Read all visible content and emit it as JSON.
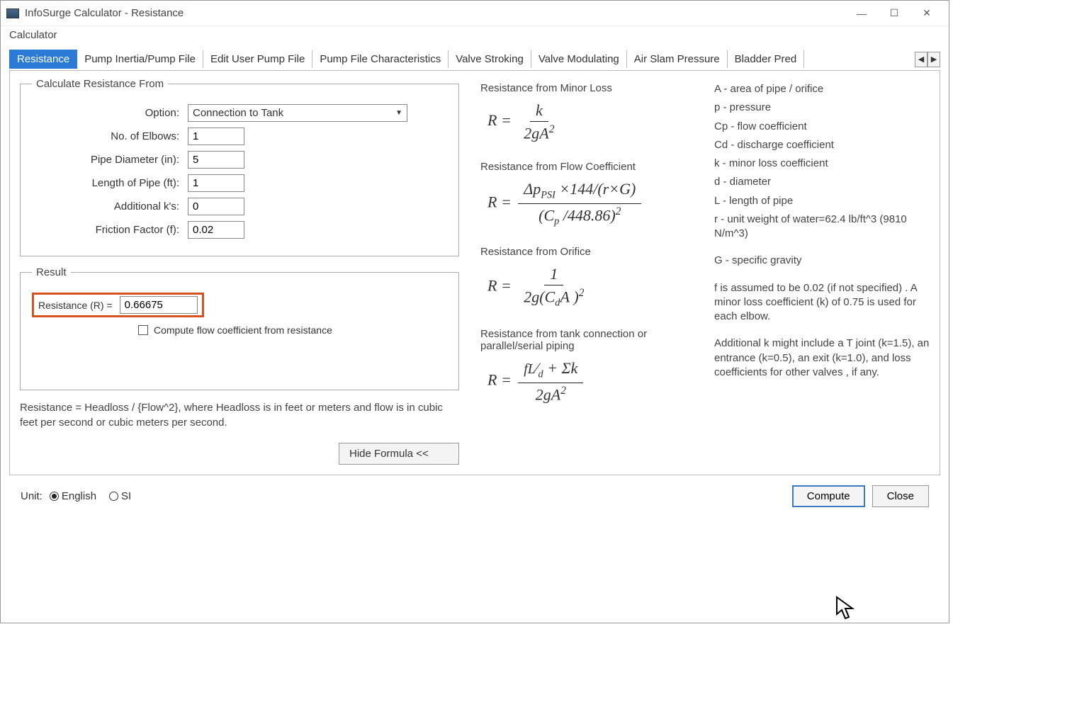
{
  "window": {
    "title": "InfoSurge Calculator - Resistance",
    "menubar_item": "Calculator"
  },
  "tabs": [
    "Resistance",
    "Pump Inertia/Pump File",
    "Edit User Pump File",
    "Pump File Characteristics",
    "Valve Stroking",
    "Valve Modulating",
    "Air Slam Pressure",
    "Bladder Pred"
  ],
  "active_tab_index": 0,
  "calc_from": {
    "legend": "Calculate Resistance From",
    "option_label": "Option:",
    "option_value": "Connection to Tank",
    "fields": [
      {
        "label": "No. of Elbows:",
        "value": "1"
      },
      {
        "label": "Pipe Diameter (in):",
        "value": "5"
      },
      {
        "label": "Length of Pipe (ft):",
        "value": "1"
      },
      {
        "label": "Additional k's:",
        "value": "0"
      },
      {
        "label": "Friction Factor (f):",
        "value": "0.02"
      }
    ]
  },
  "result": {
    "legend": "Result",
    "label": "Resistance (R)  =",
    "value": "0.66675",
    "checkbox_label": "Compute flow coefficient from resistance"
  },
  "note": "Resistance = Headloss / {Flow^2}, where Headloss is in feet or meters and flow is in cubic feet per second or cubic meters per second.",
  "hide_formula_btn": "Hide Formula <<",
  "formulas": {
    "minor_loss_label": "Resistance from Minor Loss",
    "flow_coeff_label": "Resistance from Flow Coefficient",
    "orifice_label": "Resistance from Orifice",
    "tank_label": "Resistance from tank connection or parallel/serial piping"
  },
  "glossary": [
    "A - area of pipe / orifice",
    "p - pressure",
    "Cp - flow coefficient",
    "Cd - discharge coefficient",
    "k - minor loss coefficient",
    "d - diameter",
    "L - length of pipe",
    "r - unit weight of water=62.4 lb/ft^3 (9810 N/m^3)",
    "G - specific gravity",
    "f is assumed to be 0.02 (if not specified) . A minor loss coefficient (k) of 0.75 is used for each elbow.",
    "Additional k might include a T joint (k=1.5), an entrance (k=0.5), an exit (k=1.0), and loss coefficients for other valves , if any."
  ],
  "bottom": {
    "unit_label": "Unit:",
    "english": "English",
    "si": "SI",
    "compute": "Compute",
    "close": "Close"
  }
}
